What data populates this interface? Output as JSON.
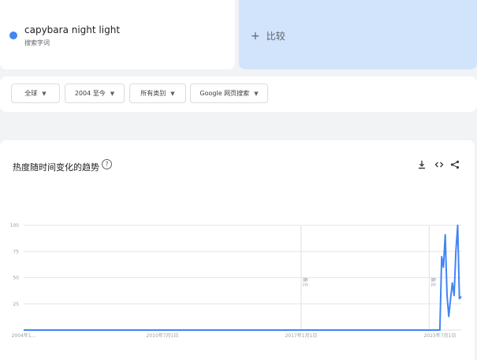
{
  "search_term": {
    "name": "capybara night light",
    "type": "搜索字词",
    "color": "#4285f4"
  },
  "compare": {
    "plus": "+",
    "label": "比较"
  },
  "filters": {
    "region": "全球",
    "time": "2004 至今",
    "category": "所有类别",
    "source": "Google 网页搜索"
  },
  "chart_panel": {
    "title": "热度随时间变化的趋势",
    "help_icon": "?",
    "icons": [
      "download-icon",
      "embed-code-icon",
      "share-icon"
    ]
  },
  "chart_data": {
    "type": "line",
    "title": "热度随时间变化的趋势",
    "xlabel": "",
    "ylabel": "",
    "ylim": [
      0,
      100
    ],
    "y_ticks": [
      "100",
      "75",
      "50",
      "25"
    ],
    "x_tick_labels": [
      "2004年1...",
      "2010年7月1日",
      "2017年1月1日",
      "2023年7月1日"
    ],
    "x_tick_dates": [
      "2004-01",
      "2010-07",
      "2017-01",
      "2023-07"
    ],
    "x_range": [
      "2004-01",
      "2024-07"
    ],
    "annotations": [
      {
        "date": "2017-01",
        "label": "备注"
      },
      {
        "date": "2023-01",
        "label": "备注"
      }
    ],
    "grid": true,
    "series": [
      {
        "color": "#4285f4",
        "x": [
          "2004-01",
          "2023-06",
          "2023-07",
          "2023-08",
          "2023-09",
          "2023-10",
          "2023-11",
          "2023-12",
          "2024-01",
          "2024-02",
          "2024-03",
          "2024-04",
          "2024-05",
          "2024-06",
          "2024-07"
        ],
        "values": [
          0,
          0,
          0,
          70,
          60,
          91,
          33,
          13,
          30,
          45,
          33,
          75,
          100,
          30,
          32
        ]
      }
    ]
  }
}
